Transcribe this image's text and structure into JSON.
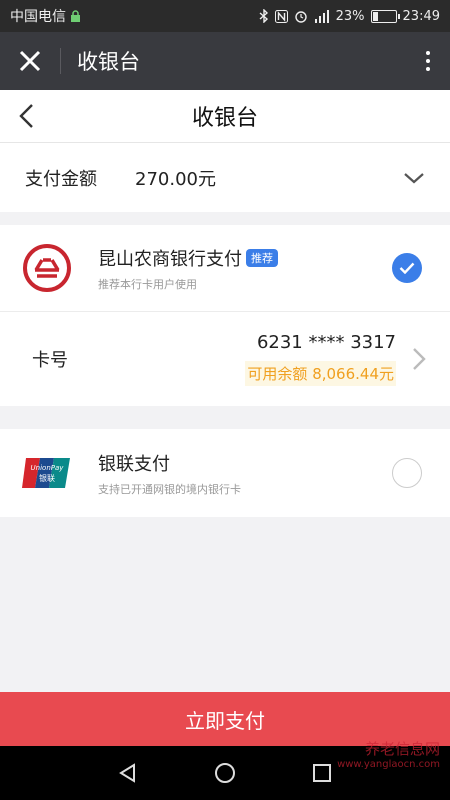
{
  "status_bar": {
    "carrier": "中国电信",
    "battery": "23%",
    "time": "23:49",
    "battery_level": 0.23
  },
  "app_bar": {
    "title": "收银台"
  },
  "page": {
    "heading": "收银台"
  },
  "amount": {
    "label": "支付金额",
    "value": "270.00元"
  },
  "methods": [
    {
      "name": "昆山农商银行支付",
      "badge": "推荐",
      "desc": "推荐本行卡用户使用",
      "selected": true
    },
    {
      "name": "银联支付",
      "desc": "支持已开通网银的境内银行卡",
      "selected": false
    }
  ],
  "card": {
    "label": "卡号",
    "number": "6231 **** 3317",
    "balance": "可用余额 8,066.44元"
  },
  "pay_button": "立即支付",
  "watermark": {
    "text": "养老信息网",
    "url": "www.yanglaocn.com"
  },
  "colors": {
    "accent_blue": "#3b7ee8",
    "pay_red": "#e84a50",
    "balance_orange": "#f0a020",
    "bank_red": "#c8262f"
  }
}
